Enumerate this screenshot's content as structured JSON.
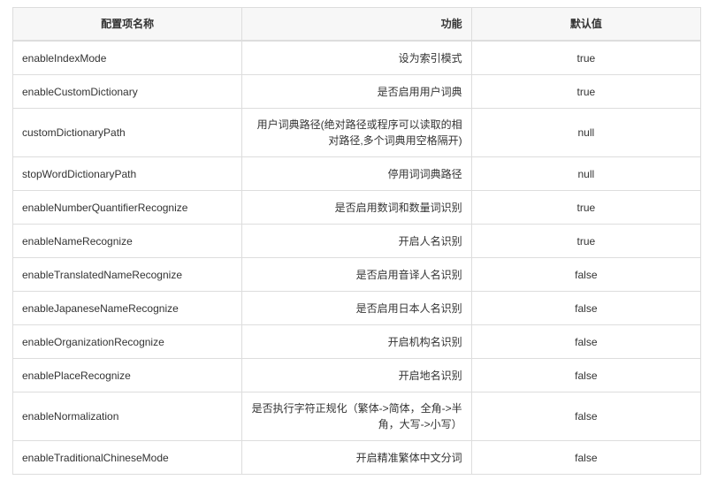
{
  "headers": [
    "配置项名称",
    "功能",
    "默认值"
  ],
  "rows": [
    {
      "name": "enableIndexMode",
      "desc": "设为索引模式",
      "default": "true"
    },
    {
      "name": "enableCustomDictionary",
      "desc": "是否启用用户词典",
      "default": "true"
    },
    {
      "name": "customDictionaryPath",
      "desc": "用户词典路径(绝对路径或程序可以读取的相对路径,多个词典用空格隔开)",
      "default": "null"
    },
    {
      "name": "stopWordDictionaryPath",
      "desc": "停用词词典路径",
      "default": "null"
    },
    {
      "name": "enableNumberQuantifierRecognize",
      "desc": "是否启用数词和数量词识别",
      "default": "true"
    },
    {
      "name": "enableNameRecognize",
      "desc": "开启人名识别",
      "default": "true"
    },
    {
      "name": "enableTranslatedNameRecognize",
      "desc": "是否启用音译人名识别",
      "default": "false"
    },
    {
      "name": "enableJapaneseNameRecognize",
      "desc": "是否启用日本人名识别",
      "default": "false"
    },
    {
      "name": "enableOrganizationRecognize",
      "desc": "开启机构名识别",
      "default": "false"
    },
    {
      "name": "enablePlaceRecognize",
      "desc": "开启地名识别",
      "default": "false"
    },
    {
      "name": "enableNormalization",
      "desc": "是否执行字符正规化（繁体->简体，全角->半角，大写->小写）",
      "default": "false"
    },
    {
      "name": "enableTraditionalChineseMode",
      "desc": "开启精准繁体中文分词",
      "default": "false"
    }
  ]
}
